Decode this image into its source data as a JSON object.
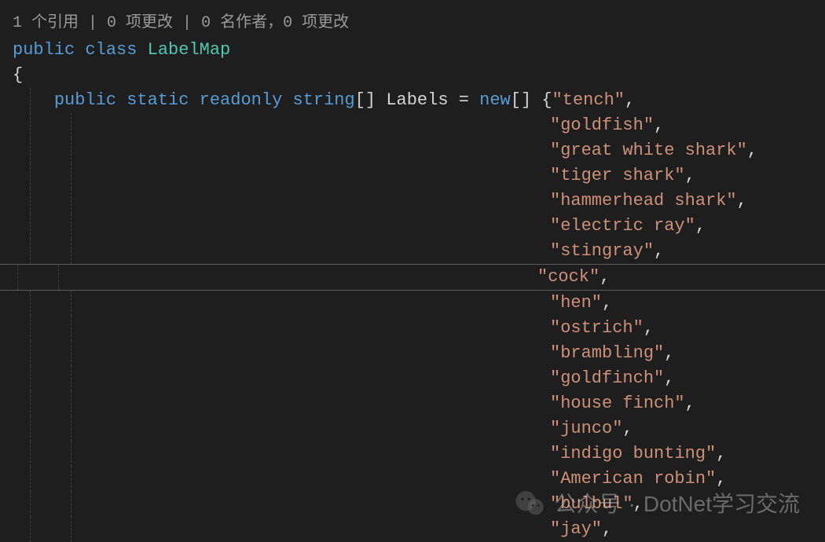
{
  "codelens": {
    "references": "1 个引用",
    "changes1": "0 项更改",
    "authors": "0 名作者",
    "changes2": "0 项更改"
  },
  "class_decl": {
    "kw_public": "public",
    "kw_class": "class",
    "name": "LabelMap"
  },
  "brace_open": "{",
  "field_decl": {
    "kw_public": "public",
    "kw_static": "static",
    "kw_readonly": "readonly",
    "kw_string": "string",
    "brackets": "[]",
    "name": "Labels",
    "equals": "=",
    "kw_new": "new",
    "brackets2": "[]",
    "brace_open": "{"
  },
  "labels": [
    "tench",
    "goldfish",
    "great white shark",
    "tiger shark",
    "hammerhead shark",
    "electric ray",
    "stingray",
    "cock",
    "hen",
    "ostrich",
    "brambling",
    "goldfinch",
    "house finch",
    "junco",
    "indigo bunting",
    "American robin",
    "bulbul",
    "jay"
  ],
  "watermark": {
    "label1": "公众号",
    "sep": "·",
    "label2": "DotNet学习交流"
  }
}
